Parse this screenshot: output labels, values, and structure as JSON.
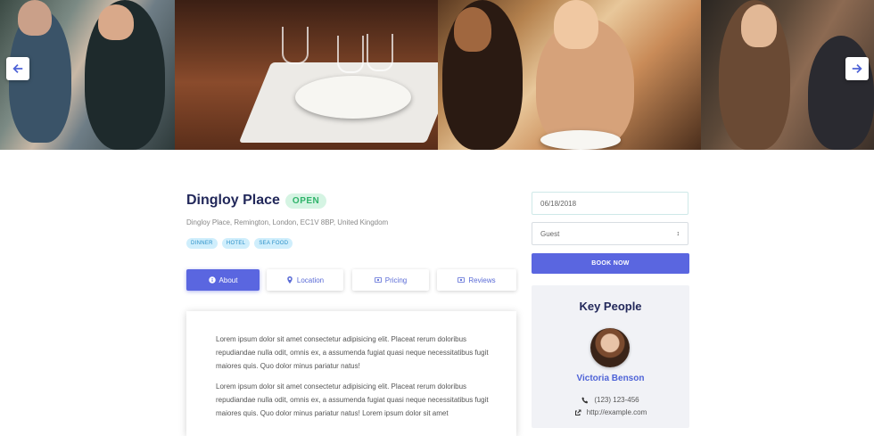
{
  "listing": {
    "name": "Dingloy Place",
    "status": "OPEN",
    "address": "Dingloy Place, Remington, London, EC1V 8BP, United Kingdom",
    "tags": [
      "DINNER",
      "HOTEL",
      "SEA FOOD"
    ]
  },
  "tabs": [
    {
      "label": "About",
      "icon": "info-icon",
      "active": true
    },
    {
      "label": "Location",
      "icon": "map-pin-icon",
      "active": false
    },
    {
      "label": "Pricing",
      "icon": "money-icon",
      "active": false
    },
    {
      "label": "Reviews",
      "icon": "money-icon",
      "active": false
    }
  ],
  "about": {
    "paragraphs": [
      "Lorem ipsum dolor sit amet consectetur adipisicing elit. Placeat rerum doloribus repudiandae nulla odit, omnis ex, a assumenda fugiat quasi neque necessitatibus fugit maiores quis. Quo dolor minus pariatur natus!",
      "Lorem ipsum dolor sit amet consectetur adipisicing elit. Placeat rerum doloribus repudiandae nulla odit, omnis ex, a assumenda fugiat quasi neque necessitatibus fugit maiores quis. Quo dolor minus pariatur natus! Lorem ipsum dolor sit amet"
    ]
  },
  "booking": {
    "date_value": "06/18/2018",
    "guest_selected": "Guest",
    "button_label": "BOOK NOW"
  },
  "key_people": {
    "title": "Key People",
    "name": "Victoria Benson",
    "phone": "(123) 123-456",
    "website": "http://example.com"
  },
  "colors": {
    "accent": "#5a66e0",
    "title": "#22285a",
    "status_green": "#2fb36a",
    "tag_blue": "#cfeefc"
  }
}
